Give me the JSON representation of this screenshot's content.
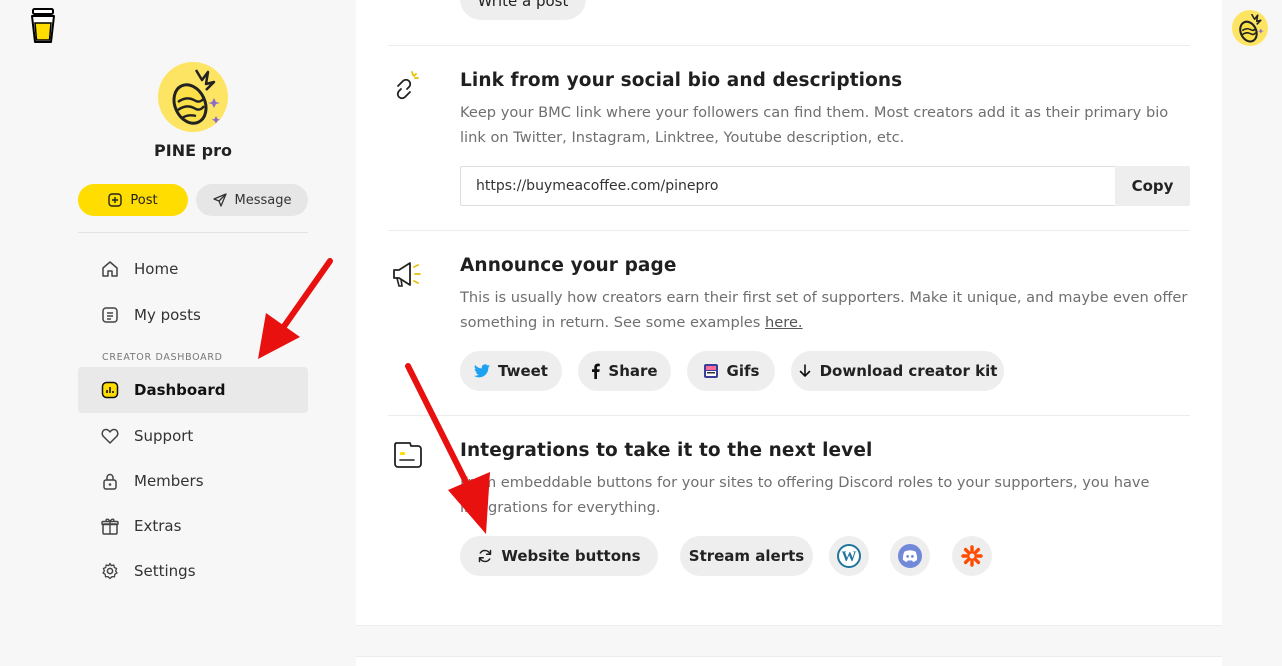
{
  "profile": {
    "name": "PINE pro"
  },
  "actions": {
    "post_label": "Post",
    "message_label": "Message"
  },
  "nav": {
    "home": "Home",
    "my_posts": "My posts",
    "section": "CREATOR DASHBOARD",
    "dashboard": "Dashboard",
    "support": "Support",
    "members": "Members",
    "extras": "Extras",
    "settings": "Settings"
  },
  "main": {
    "write_post": "Write a post",
    "link_section": {
      "title": "Link from your social bio and descriptions",
      "description": "Keep your BMC link where your followers can find them. Most creators add it as their primary bio link on Twitter, Instagram, Linktree, Youtube description, etc.",
      "url": "https://buymeacoffee.com/pinepro",
      "copy_label": "Copy"
    },
    "announce_section": {
      "title": "Announce your page",
      "description": "This is usually how creators earn their first set of supporters. Make it unique, and maybe even offer something in return. See some examples ",
      "link_text": "here.",
      "buttons": [
        "Tweet",
        "Share",
        "Gifs",
        "Download creator kit"
      ]
    },
    "integrations_section": {
      "title": "Integrations to take it to the next level",
      "description": "From embeddable buttons for your sites to offering Discord roles to your supporters, you have integrations for everything.",
      "buttons": [
        "Website buttons",
        "Stream alerts"
      ],
      "icons": [
        "wordpress-icon",
        "discord-icon",
        "zapier-icon"
      ]
    }
  },
  "colors": {
    "accent": "#ffdd00",
    "annotation_arrow": "#e8110f",
    "twitter": "#1da1f2",
    "wordpress": "#21759b",
    "discord": "#7289da",
    "zapier": "#ff4a00"
  }
}
